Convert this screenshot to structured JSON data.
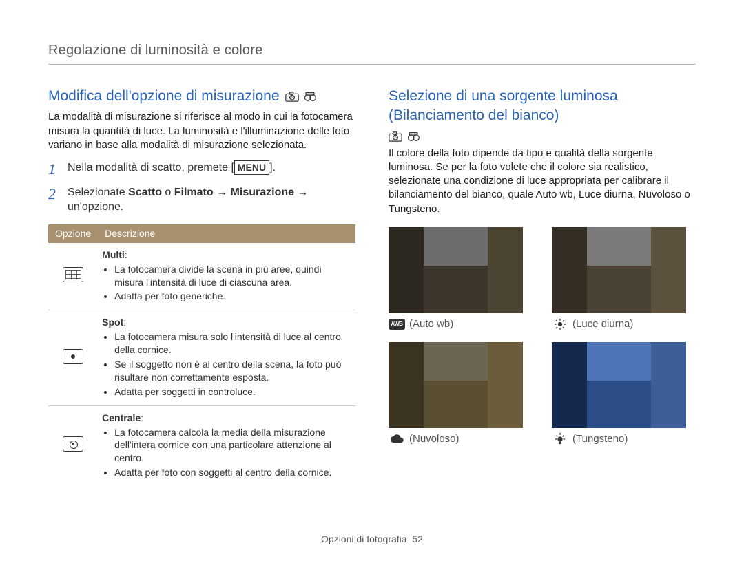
{
  "page_header": "Regolazione di luminosità e colore",
  "left": {
    "title": "Modifica dell'opzione di misurazione",
    "intro": "La modalità di misurazione si riferisce al modo in cui la fotocamera misura la quantità di luce. La luminosità e l'illuminazione delle foto variano in base alla modalità di misurazione selezionata.",
    "step1_pre": "Nella modalità di scatto, premete [",
    "step1_key": "MENU",
    "step1_post": "].",
    "step2_pre": "Selezionate ",
    "step2_b1": "Scatto",
    "step2_mid1": " o ",
    "step2_b2": "Filmato",
    "step2_arrow": " → ",
    "step2_b3": "Misurazione",
    "step2_post": " → un'opzione.",
    "table": {
      "h1": "Opzione",
      "h2": "Descrizione",
      "rows": [
        {
          "name": "Multi",
          "bullets": [
            "La fotocamera divide la scena in più aree, quindi misura l'intensità di luce di ciascuna area.",
            "Adatta per foto generiche."
          ]
        },
        {
          "name": "Spot",
          "bullets": [
            "La fotocamera misura solo l'intensità di luce al centro della cornice.",
            "Se il soggetto non è al centro della scena, la foto può risultare non correttamente esposta.",
            "Adatta per soggetti in controluce."
          ]
        },
        {
          "name": "Centrale",
          "bullets": [
            "La fotocamera calcola la media della misurazione dell'intera cornice con una particolare attenzione al centro.",
            "Adatta per foto con soggetti al centro della cornice."
          ]
        }
      ]
    }
  },
  "right": {
    "title": "Selezione di una sorgente luminosa (Bilanciamento del bianco)",
    "intro": "Il colore della foto dipende da tipo e qualità della sorgente luminosa. Se per la foto volete che il colore sia realistico, selezionate una condizione di luce appropriata per calibrare il bilanciamento del bianco, quale Auto wb, Luce diurna, Nuvoloso o Tungsteno.",
    "thumbs": {
      "auto": "(Auto wb)",
      "daylight": "(Luce diurna)",
      "cloudy": "(Nuvoloso)",
      "tungsten": "(Tungsteno)",
      "awb_label": "AWB"
    }
  },
  "footer_text": "Opzioni di fotografia",
  "footer_page": "52"
}
